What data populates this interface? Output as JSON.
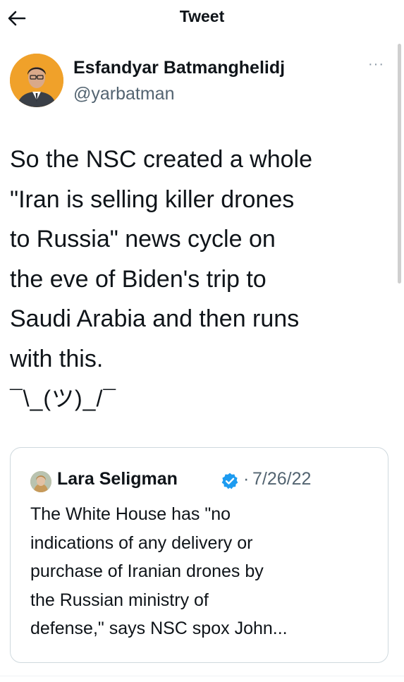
{
  "header": {
    "title": "Tweet",
    "back_icon": "arrow-left-icon"
  },
  "tweet": {
    "author_name": "Esfandyar Batmanghelidj",
    "author_handle": "@yarbatman",
    "more_label": "···",
    "text": "So the NSC created a whole\n\"Iran is selling killer drones\nto Russia\" news cycle on\nthe eve of Biden's trip to\nSaudi Arabia and then runs\nwith this.",
    "shrug": "¯\\_(ツ)_/¯"
  },
  "quoted_tweet": {
    "author_name": "Lara Seligman",
    "verified_icon": "verified-badge-icon",
    "separator": "·",
    "date": "7/26/22",
    "text": "The White House has \"no\nindications of any delivery or\npurchase of Iranian drones by\nthe Russian ministry of\ndefense,\" says NSC spox John..."
  },
  "colors": {
    "text_primary": "#0f1419",
    "text_secondary": "#536471",
    "border": "#cfd9de",
    "verified_blue": "#1d9bf0",
    "avatar_bg": "#f0a12a"
  }
}
